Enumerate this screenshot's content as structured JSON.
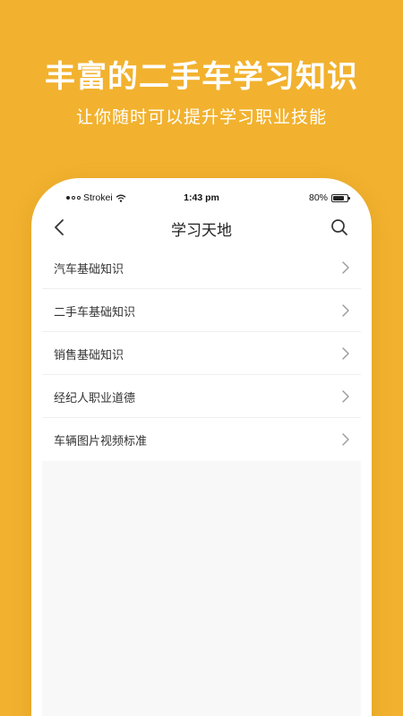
{
  "promo": {
    "title": "丰富的二手车学习知识",
    "subtitle": "让你随时可以提升学习职业技能"
  },
  "status_bar": {
    "carrier": "Strokei",
    "time": "1:43 pm",
    "battery": "80%",
    "battery_level": 0.8
  },
  "nav": {
    "title": "学习天地",
    "back_icon": "chevron-left-icon",
    "search_icon": "search-icon"
  },
  "list": {
    "items": [
      {
        "label": "汽车基础知识"
      },
      {
        "label": "二手车基础知识"
      },
      {
        "label": "销售基础知识"
      },
      {
        "label": "经纪人职业道德"
      },
      {
        "label": "车辆图片视频标准"
      }
    ]
  },
  "colors": {
    "background": "#F2B22F",
    "card": "#FFFFFF",
    "text": "#333333"
  }
}
